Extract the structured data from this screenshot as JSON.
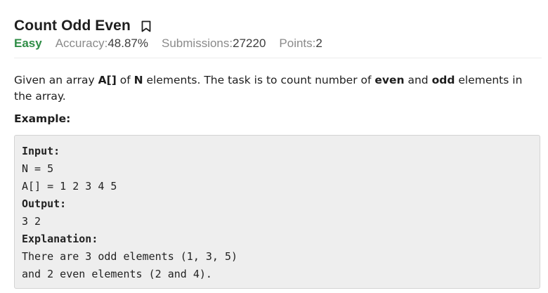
{
  "problem": {
    "title": "Count Odd Even",
    "difficulty": "Easy",
    "accuracy_label": "Accuracy: ",
    "accuracy_value": "48.87%",
    "submissions_label": "Submissions: ",
    "submissions_value": "27220",
    "points_label": "Points: ",
    "points_value": "2",
    "bookmark_icon": "bookmark-icon"
  },
  "description": {
    "part1": "Given an array ",
    "array_name": "A[]",
    "part2": " of ",
    "n_name": "N",
    "part3": " elements. The task is to count number of ",
    "even_word": "even",
    "part4": " and ",
    "odd_word": "odd",
    "part5": " elements in the array."
  },
  "example": {
    "heading": "Example:",
    "input_label": "Input:",
    "input_line1": "N = 5",
    "input_line2": "A[] = 1 2 3 4 5",
    "output_label": "Output:",
    "output_value": "3 2",
    "explanation_label": "Explanation:",
    "explanation_line1": "There are 3 odd elements (1, 3, 5)",
    "explanation_line2": "and 2 even elements (2 and 4)."
  },
  "colors": {
    "difficulty_easy": "#2f8d46",
    "muted": "#8a8a8a",
    "code_bg": "#eeeeee"
  }
}
